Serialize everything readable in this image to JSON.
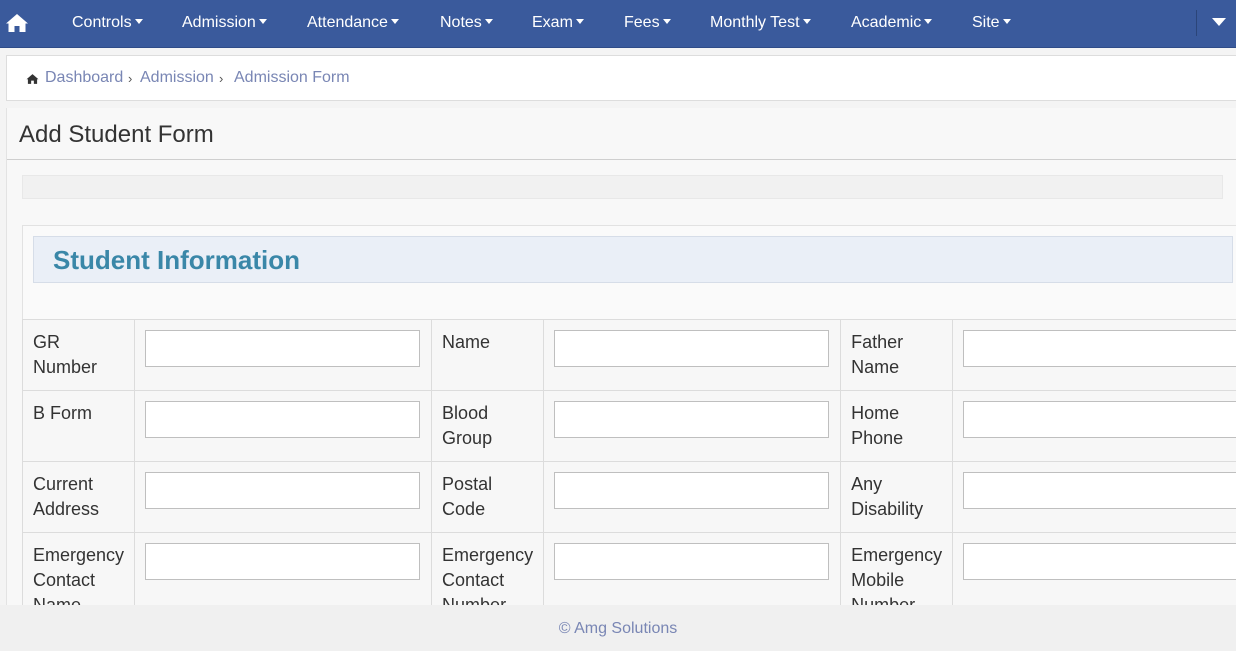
{
  "navbar": {
    "home_icon": "home-icon",
    "items": [
      {
        "label": "Controls"
      },
      {
        "label": "Admission"
      },
      {
        "label": "Attendance"
      },
      {
        "label": "Notes"
      },
      {
        "label": "Exam"
      },
      {
        "label": "Fees"
      },
      {
        "label": "Monthly Test"
      },
      {
        "label": "Academic"
      },
      {
        "label": "Site"
      }
    ],
    "bg_color": "#3a5a9c"
  },
  "breadcrumb": {
    "items": [
      "Dashboard",
      "Admission",
      "Admission Form"
    ],
    "separator": "›",
    "link_color": "#7986b4"
  },
  "page": {
    "title": "Add Student Form"
  },
  "section": {
    "title": "Student Information",
    "title_color": "#3a87a8"
  },
  "form": {
    "rows": [
      [
        {
          "label": "GR Number",
          "value": ""
        },
        {
          "label": "Name",
          "value": ""
        },
        {
          "label": "Father Name",
          "value": ""
        }
      ],
      [
        {
          "label": "B Form",
          "value": ""
        },
        {
          "label": "Blood Group",
          "value": ""
        },
        {
          "label": "Home Phone",
          "value": ""
        }
      ],
      [
        {
          "label": "Current Address",
          "value": ""
        },
        {
          "label": "Postal Code",
          "value": ""
        },
        {
          "label": "Any Disability",
          "value": ""
        }
      ],
      [
        {
          "label": "Emergency Contact Name",
          "value": ""
        },
        {
          "label": "Emergency Contact Number",
          "value": ""
        },
        {
          "label": "Emergency Mobile Number",
          "value": ""
        }
      ]
    ]
  },
  "footer": {
    "text": "© Amg Solutions"
  }
}
